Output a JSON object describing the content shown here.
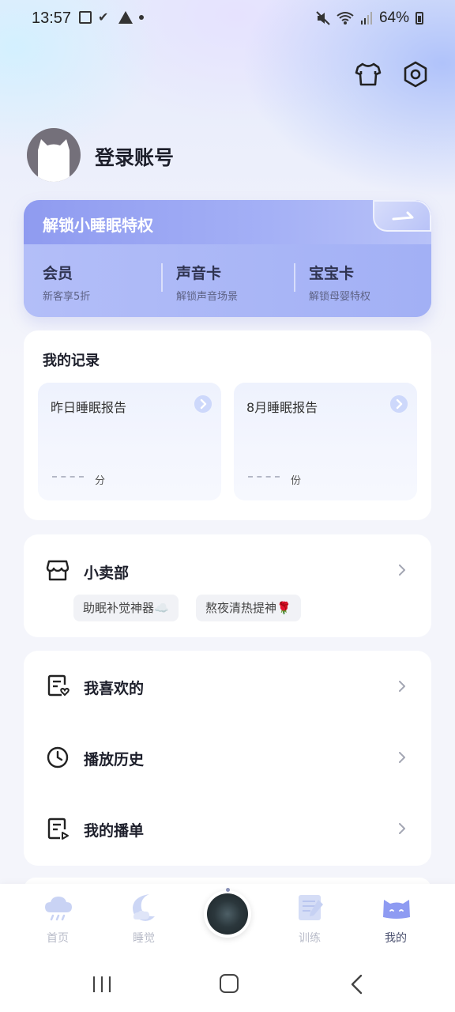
{
  "status_bar": {
    "time": "13:57",
    "battery": "64%",
    "icons_left": [
      "image-icon",
      "check-icon",
      "warning-icon",
      "dot-icon"
    ],
    "icons_right": [
      "mute-icon",
      "wifi-icon",
      "signal-icon",
      "battery-icon"
    ]
  },
  "header": {
    "icons": [
      "shirt-icon",
      "settings-icon"
    ]
  },
  "profile": {
    "login_label": "登录账号"
  },
  "vip": {
    "title": "解锁小睡眠特权",
    "items": [
      {
        "title": "会员",
        "subtitle": "新客享5折"
      },
      {
        "title": "声音卡",
        "subtitle": "解锁声音场景"
      },
      {
        "title": "宝宝卡",
        "subtitle": "解锁母婴特权"
      }
    ]
  },
  "records": {
    "title": "我的记录",
    "reports": [
      {
        "title": "昨日睡眠报告",
        "value": "— —",
        "unit": "分"
      },
      {
        "title": "8月睡眠报告",
        "value": "— —",
        "unit": "份"
      }
    ]
  },
  "shop": {
    "label": "小卖部",
    "tags": [
      "助眠补觉神器☁️",
      "熬夜清热提神🌹"
    ]
  },
  "menu": {
    "items": [
      {
        "label": "我喜欢的",
        "icon": "favorites-list-icon"
      },
      {
        "label": "播放历史",
        "icon": "clock-icon"
      },
      {
        "label": "我的播单",
        "icon": "playlist-icon"
      }
    ]
  },
  "bottom_nav": {
    "items": [
      {
        "label": "首页",
        "icon": "rain-cloud-icon",
        "active": false
      },
      {
        "label": "睡觉",
        "icon": "moon-icon",
        "active": false
      },
      {
        "label": "训练",
        "icon": "notebook-icon",
        "active": false
      },
      {
        "label": "我的",
        "icon": "cat-icon",
        "active": true
      }
    ]
  },
  "colors": {
    "accent": "#9aa9f4",
    "active_nav": "#4c5270",
    "inactive_nav": "#b9bcc9"
  }
}
